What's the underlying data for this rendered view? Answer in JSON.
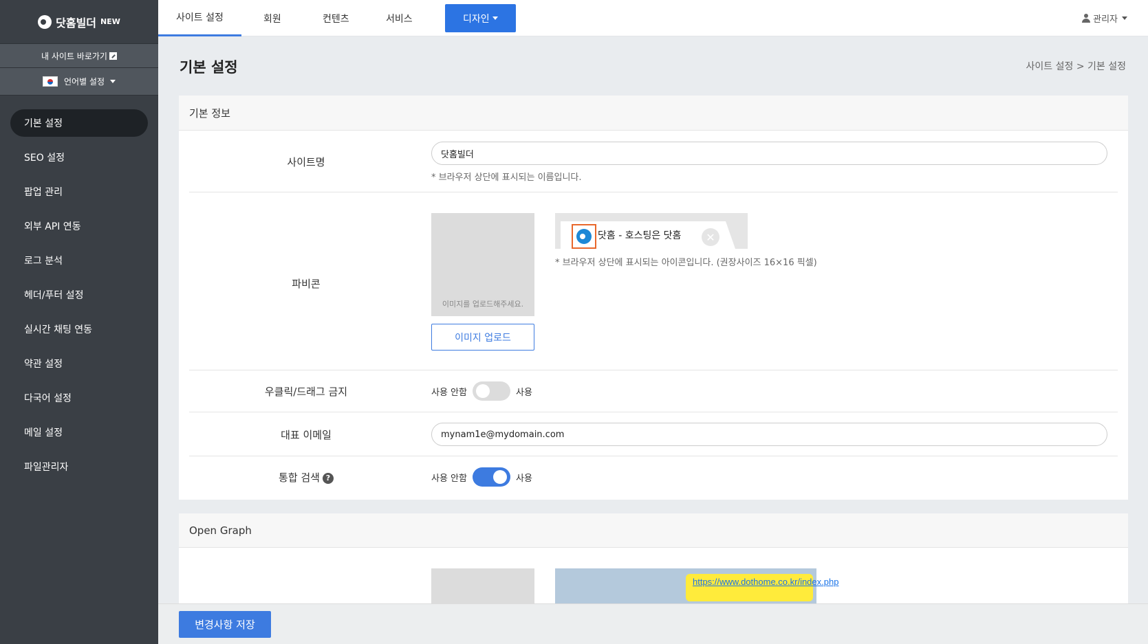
{
  "brand": {
    "name": "닷홈빌더",
    "badge": "NEW"
  },
  "sidebar": {
    "site_link": "내 사이트 바로가기",
    "language": "언어별 설정",
    "items": [
      {
        "label": "기본 설정",
        "active": true
      },
      {
        "label": "SEO 설정"
      },
      {
        "label": "팝업 관리"
      },
      {
        "label": "외부 API 연동"
      },
      {
        "label": "로그 분석"
      },
      {
        "label": "헤더/푸터 설정"
      },
      {
        "label": "실시간 채팅 연동"
      },
      {
        "label": "약관 설정"
      },
      {
        "label": "다국어 설정"
      },
      {
        "label": "메일 설정"
      },
      {
        "label": "파일관리자"
      }
    ]
  },
  "topnav": {
    "tabs": [
      "사이트 설정",
      "회원",
      "컨텐츠",
      "서비스",
      "디자인"
    ],
    "user": "관리자"
  },
  "page": {
    "title": "기본 설정",
    "breadcrumb": "사이트 설정 > 기본 설정"
  },
  "basic_info": {
    "heading": "기본 정보",
    "site_name": {
      "label": "사이트명",
      "value": "닷홈빌더",
      "help": "* 브라우저 상단에 표시되는 이름입니다."
    },
    "favicon": {
      "label": "파비콘",
      "placeholder": "이미지를 업로드해주세요.",
      "upload_button": "이미지 업로드",
      "tab_title": "닷홈 - 호스팅은 닷홈",
      "help": "* 브라우저 상단에 표시되는 아이콘입니다. (권장사이즈 16×16 픽셀)"
    },
    "right_click": {
      "label": "우클릭/드래그 금지",
      "off_label": "사용 안함",
      "on_label": "사용",
      "enabled": false
    },
    "email": {
      "label": "대표 이메일",
      "value": "mynam1e@mydomain.com"
    },
    "search": {
      "label": "통합 검색",
      "off_label": "사용 안함",
      "on_label": "사용",
      "enabled": true
    }
  },
  "open_graph": {
    "heading": "Open Graph",
    "link_text": "https://www.dothome.co.kr/index.php"
  },
  "footer": {
    "save_button": "변경사항 저장"
  },
  "colors": {
    "accent": "#3d7be0",
    "sidebar": "#3a3f45",
    "highlight": "#e8672b"
  }
}
